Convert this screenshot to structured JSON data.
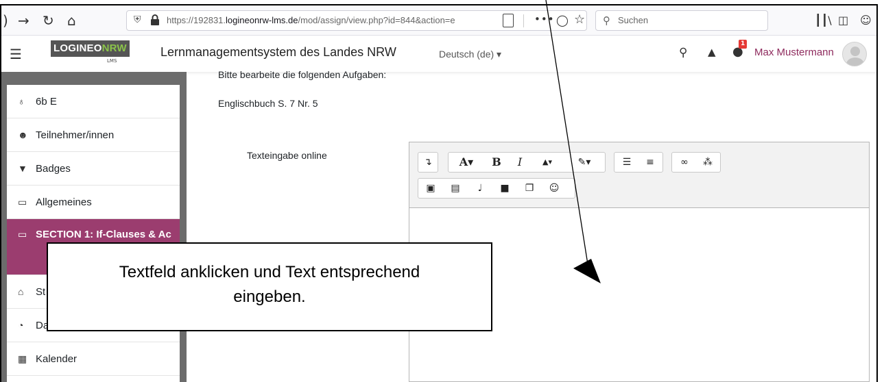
{
  "browser": {
    "url_prefix": "https://192831.",
    "url_domain": "logineonrw-lms.de",
    "url_path": "/mod/assign/view.php?id=844&action=e",
    "more_icon": "•••",
    "search_placeholder": "Suchen",
    "icons": [
      "back-icon",
      "forward-icon",
      "reload-icon",
      "home-icon",
      "shield-icon",
      "lock-icon",
      "reader-icon",
      "pocket-icon",
      "star-icon",
      "library-icon",
      "sidebar-icon",
      "account-icon"
    ]
  },
  "navbar": {
    "logo_main": "LOGINEO",
    "logo_accent": "NRW",
    "logo_sub": "LMS",
    "site_title": "Lernmanagementsystem des Landes NRW",
    "language": "Deutsch (de) ▾",
    "message_count": "1",
    "user_name": "Max Mustermann"
  },
  "sidebar": {
    "items": [
      {
        "label": "6b E",
        "icon": "graduation-cap-icon",
        "glyph": "♁"
      },
      {
        "label": "Teilnehmer/innen",
        "icon": "users-icon",
        "glyph": "☻"
      },
      {
        "label": "Badges",
        "icon": "shield-icon",
        "glyph": "▼"
      },
      {
        "label": "Allgemeines",
        "icon": "folder-icon",
        "glyph": "▭"
      },
      {
        "label": "SECTION 1: If-Clauses & Ac",
        "icon": "folder-icon",
        "glyph": "▭"
      },
      {
        "label": "St",
        "icon": "home-icon",
        "glyph": "⌂"
      },
      {
        "label": "Da",
        "icon": "dashboard-icon",
        "glyph": "◔"
      },
      {
        "label": "Kalender",
        "icon": "calendar-icon",
        "glyph": "▦"
      }
    ]
  },
  "main": {
    "task_text": "Bitte bearbeite die folgenden Aufgaben:",
    "task_ref": "Englischbuch S. 7 Nr. 5",
    "field_label": "Texteingabe online"
  },
  "editor": {
    "row1": [
      {
        "name": "collapse-toolbar-icon",
        "glyph": "↴"
      },
      {
        "name": "font-style-dropdown",
        "glyph": "A▾"
      },
      {
        "name": "bold-button",
        "glyph": "B"
      },
      {
        "name": "italic-button",
        "glyph": "I"
      },
      {
        "name": "font-color-dropdown",
        "glyph": "▲▾"
      },
      {
        "name": "background-color-dropdown",
        "glyph": "✎▾"
      },
      {
        "name": "unordered-list-icon",
        "glyph": "☰"
      },
      {
        "name": "ordered-list-icon",
        "glyph": "≡"
      },
      {
        "name": "link-icon",
        "glyph": "∞"
      },
      {
        "name": "unlink-icon",
        "glyph": "⁂"
      }
    ],
    "row2": [
      {
        "name": "image-icon",
        "glyph": "▣"
      },
      {
        "name": "media-icon",
        "glyph": "▤"
      },
      {
        "name": "microphone-icon",
        "glyph": "♩"
      },
      {
        "name": "video-icon",
        "glyph": "■"
      },
      {
        "name": "copy-icon",
        "glyph": "❐"
      },
      {
        "name": "emoji-icon",
        "glyph": "☺"
      }
    ]
  },
  "callout": {
    "line1": "Textfeld anklicken und Text entsprechend",
    "line2": "eingeben."
  },
  "colors": {
    "accent": "#9b3d6f",
    "user": "#8e2a5d",
    "logo_green": "#8bc34a",
    "badge": "#e53935"
  }
}
